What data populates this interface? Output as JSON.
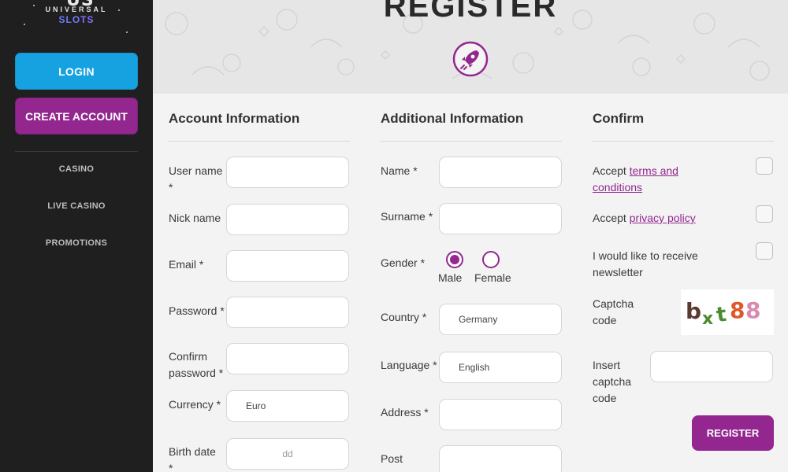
{
  "logo": {
    "mark": "US",
    "line1": "UNIVERSAL",
    "line2": "SLOTS"
  },
  "sidebar": {
    "login_label": "LOGIN",
    "create_label": "CREATE ACCOUNT",
    "items": [
      {
        "label": "CASINO"
      },
      {
        "label": "LIVE CASINO"
      },
      {
        "label": "PROMOTIONS"
      }
    ]
  },
  "header": {
    "title": "REGISTER",
    "icon": "rocket-icon"
  },
  "account": {
    "title": "Account Information",
    "username_label": "User name",
    "username_star": "*",
    "nickname_label": "Nick name",
    "email_label": "Email *",
    "password_label": "Password *",
    "confirm_label_1": "Confirm",
    "confirm_label_2": "password *",
    "currency_label": "Currency *",
    "currency_value": "Euro",
    "birthdate_label": "Birth date",
    "birthdate_star": "*",
    "birthdate_placeholder": "dd"
  },
  "additional": {
    "title": "Additional Information",
    "name_label": "Name *",
    "surname_label": "Surname *",
    "gender_label": "Gender *",
    "gender_male": "Male",
    "gender_female": "Female",
    "gender_selected": "Male",
    "country_label": "Country *",
    "country_value": "Germany",
    "language_label": "Language *",
    "language_value": "English",
    "address_label": "Address *",
    "post_label": "Post"
  },
  "confirm": {
    "title": "Confirm",
    "terms_prefix": "Accept ",
    "terms_link_1": "terms and",
    "terms_link_2": "conditions",
    "privacy_prefix": "Accept ",
    "privacy_link": "privacy policy",
    "newsletter_1": "I would like to receive",
    "newsletter_2": "newsletter",
    "captcha_label_1": "Captcha",
    "captcha_label_2": "code",
    "captcha_text": "bxt88",
    "insert_1": "Insert",
    "insert_2": "captcha",
    "insert_3": "code",
    "register_label": "REGISTER"
  },
  "colors": {
    "accent": "#93278f",
    "login": "#16a2e0",
    "sidebar": "#1f1f1f"
  }
}
